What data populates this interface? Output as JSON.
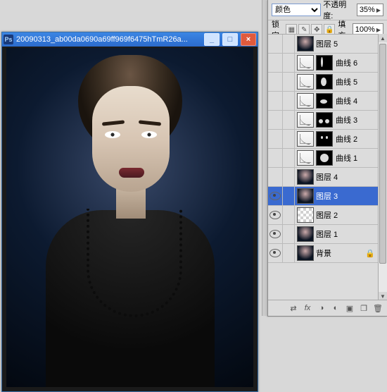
{
  "doc_window": {
    "title": "20090313_ab00da0690a69ff969f6475hTmR26a..."
  },
  "panel": {
    "blend_mode": "颜色",
    "opacity_label": "不透明度:",
    "opacity_value": "35%",
    "lock_label": "锁定:",
    "fill_label": "填充:",
    "fill_value": "100%"
  },
  "layers": [
    {
      "name": "图层 5",
      "type": "thumb",
      "visible": false,
      "selected": false,
      "locked": false
    },
    {
      "name": "曲线 6",
      "type": "curve",
      "visible": false,
      "selected": false,
      "locked": false,
      "mask": [
        {
          "l": 6,
          "t": 2,
          "w": 3,
          "h": 14
        }
      ]
    },
    {
      "name": "曲线 5",
      "type": "curve",
      "visible": false,
      "selected": false,
      "locked": false,
      "mask": [
        {
          "l": 6,
          "t": 4,
          "w": 8,
          "h": 12
        }
      ]
    },
    {
      "name": "曲线 4",
      "type": "curve",
      "visible": false,
      "selected": false,
      "locked": false,
      "mask": [
        {
          "l": 5,
          "t": 8,
          "w": 10,
          "h": 6
        }
      ]
    },
    {
      "name": "曲线 3",
      "type": "curve",
      "visible": false,
      "selected": false,
      "locked": false,
      "mask": [
        {
          "l": 3,
          "t": 9,
          "w": 6,
          "h": 6
        },
        {
          "l": 12,
          "t": 9,
          "w": 6,
          "h": 6
        }
      ]
    },
    {
      "name": "曲线 2",
      "type": "curve",
      "visible": false,
      "selected": false,
      "locked": false,
      "mask": [
        {
          "l": 6,
          "t": 6,
          "w": 3,
          "h": 4
        },
        {
          "l": 13,
          "t": 6,
          "w": 3,
          "h": 4
        }
      ]
    },
    {
      "name": "曲线 1",
      "type": "curve",
      "visible": false,
      "selected": false,
      "locked": false,
      "mask": [
        {
          "l": 5,
          "t": 4,
          "w": 12,
          "h": 12
        }
      ]
    },
    {
      "name": "图层 4",
      "type": "thumb",
      "visible": false,
      "selected": false,
      "locked": false
    },
    {
      "name": "图层 3",
      "type": "thumb",
      "visible": true,
      "selected": true,
      "locked": false
    },
    {
      "name": "图层 2",
      "type": "trans",
      "visible": true,
      "selected": false,
      "locked": false
    },
    {
      "name": "图层 1",
      "type": "thumb",
      "visible": true,
      "selected": false,
      "locked": false
    },
    {
      "name": "背景",
      "type": "thumb",
      "visible": true,
      "selected": false,
      "locked": true
    }
  ],
  "bottombar_icons": [
    "link-icon",
    "fx-icon",
    "mask-icon",
    "fill-adj-icon",
    "group-icon",
    "new-layer-icon",
    "trash-icon"
  ]
}
